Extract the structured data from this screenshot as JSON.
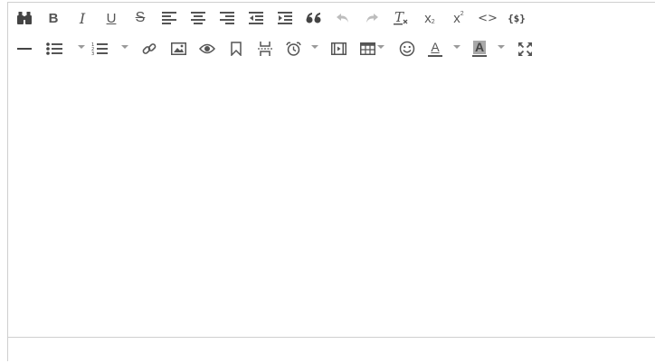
{
  "toolbar": {
    "row1": [
      "find-replace-icon",
      "bold-icon",
      "italic-icon",
      "underline-icon",
      "strikethrough-icon",
      "align-left-icon",
      "align-center-icon",
      "align-right-icon",
      "outdent-icon",
      "indent-icon",
      "blockquote-icon",
      "undo-icon",
      "redo-icon",
      "remove-format-icon",
      "subscript-icon",
      "superscript-icon",
      "code-icon",
      "template-icon"
    ],
    "row2": [
      "horizontal-rule-icon",
      "bullet-list-icon",
      "numbered-list-icon",
      "link-icon",
      "image-icon",
      "preview-icon",
      "bookmark-icon",
      "page-break-icon",
      "alarm-icon",
      "media-icon",
      "table-icon",
      "emoji-icon",
      "text-color-icon",
      "background-color-icon",
      "fullscreen-icon"
    ],
    "bold_glyph": "B",
    "italic_glyph": "I",
    "underline_glyph": "U",
    "strike_glyph": "S",
    "subscript_glyph": "x",
    "superscript_glyph": "x",
    "subscript_index": "2",
    "superscript_index": "2",
    "code_glyph": "<>",
    "template_glyph": "{$}",
    "text_color_glyph": "A",
    "bg_color_glyph": "A",
    "blockquote_glyph": "66"
  },
  "content": {
    "text": ""
  },
  "statusbar": {
    "text": ""
  }
}
